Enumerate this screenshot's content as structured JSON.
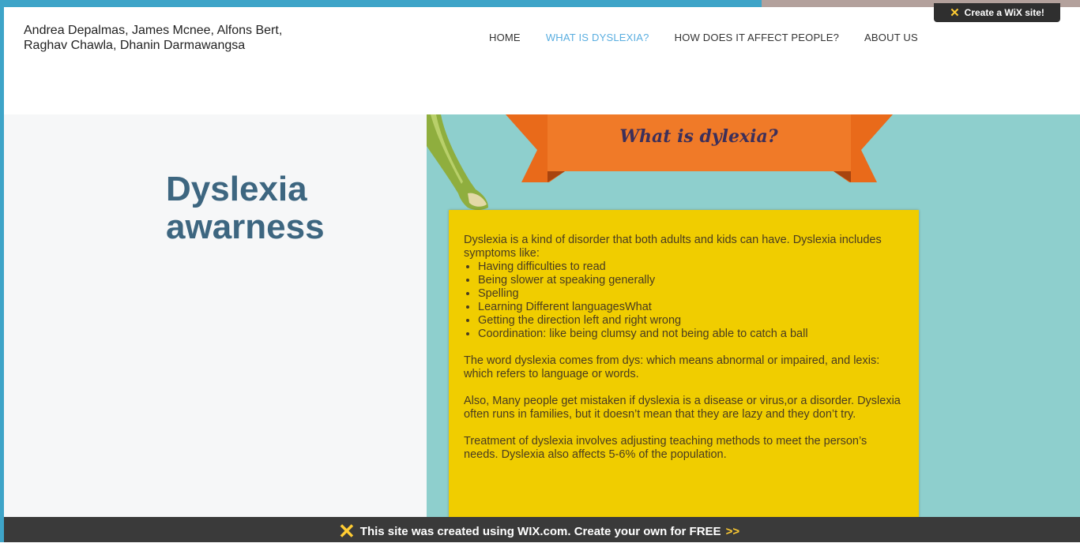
{
  "header": {
    "authors_line1": "Andrea Depalmas, James Mcnee, Alfons Bert,",
    "authors_line2": "Raghav Chawla, Dhanin Darmawangsa"
  },
  "nav": {
    "items": [
      {
        "label": "HOME"
      },
      {
        "label": "WHAT IS DYSLEXIA?",
        "active": true
      },
      {
        "label": "HOW DOES IT AFFECT PEOPLE?"
      },
      {
        "label": "ABOUT US"
      }
    ]
  },
  "wix_badge": {
    "label": "Create a WiX site!"
  },
  "hero": {
    "title_line1": "Dyslexia",
    "title_line2": "awarness"
  },
  "ribbon": {
    "title": "What is dylexia?"
  },
  "content": {
    "intro": "Dyslexia is a kind of disorder that both adults and kids can have. Dyslexia includes symptoms like:",
    "symptoms": [
      "Having difficulties to read",
      "Being slower at speaking generally",
      "Spelling",
      "Learning Different languagesWhat",
      "Getting the direction left and right wrong",
      "Coordination: like being clumsy and not being able to catch a ball"
    ],
    "para2": "The word dyslexia comes from dys: which means abnormal or impaired, and lexis: which refers to language or words.",
    "para3": "Also, Many people get mistaken if dyslexia is a disease or virus,or a disorder. Dyslexia often runs in families, but it doesn’t mean that they are lazy and they don’t try.",
    "para4": "Treatment of dyslexia involves adjusting teaching methods to meet the person’s needs. Dyslexia also affects 5-6% of the population."
  },
  "footer": {
    "text": "This site was created using WIX.com. Create your own for FREE",
    "arrows": ">>"
  },
  "colors": {
    "frame": "#3ea4c8",
    "teal": "#8ecfcd",
    "ribbon": "#ee7322",
    "box": "#f0cd00",
    "title": "#3d6680",
    "active_nav": "#5aaee0"
  }
}
